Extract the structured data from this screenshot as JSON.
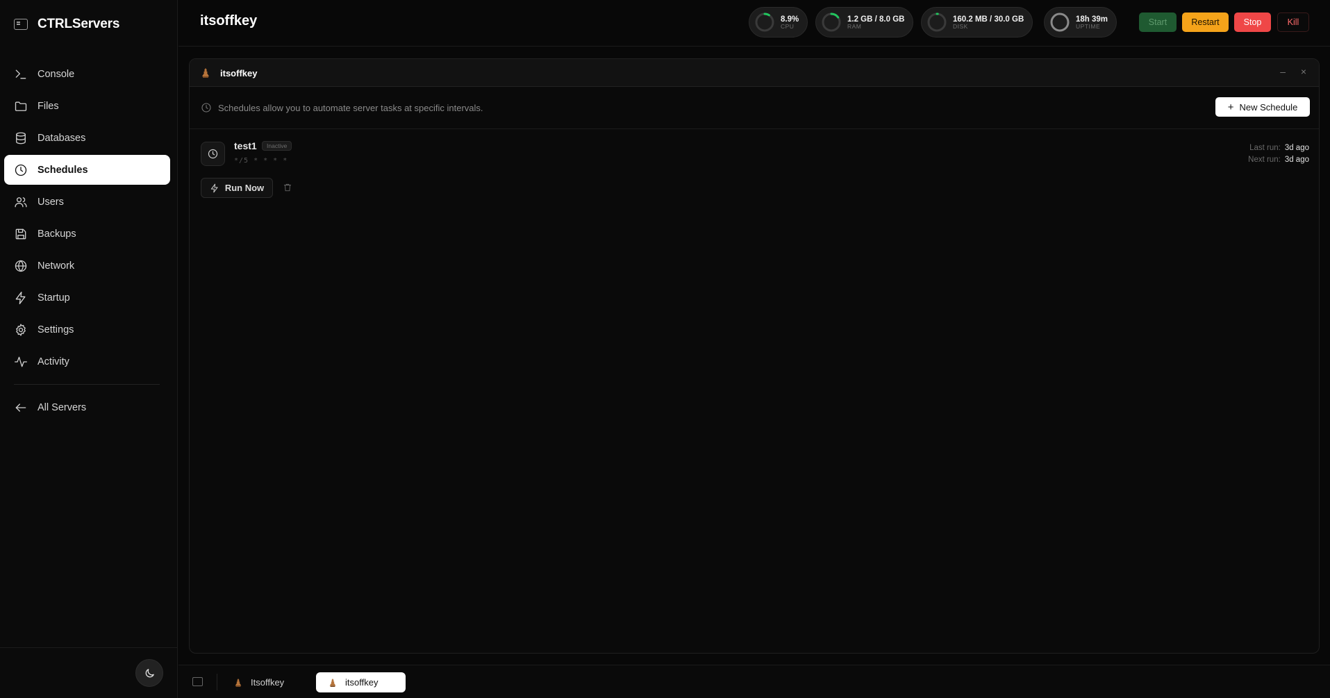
{
  "brand": {
    "name": "CTRLServers"
  },
  "sidebar": {
    "items": [
      {
        "label": "Console",
        "icon": "terminal-icon",
        "active": false
      },
      {
        "label": "Files",
        "icon": "folder-icon",
        "active": false
      },
      {
        "label": "Databases",
        "icon": "database-icon",
        "active": false
      },
      {
        "label": "Schedules",
        "icon": "clock-icon",
        "active": true
      },
      {
        "label": "Users",
        "icon": "users-icon",
        "active": false
      },
      {
        "label": "Backups",
        "icon": "save-icon",
        "active": false
      },
      {
        "label": "Network",
        "icon": "globe-icon",
        "active": false
      },
      {
        "label": "Startup",
        "icon": "lightning-icon",
        "active": false
      },
      {
        "label": "Settings",
        "icon": "gear-icon",
        "active": false
      },
      {
        "label": "Activity",
        "icon": "activity-icon",
        "active": false
      }
    ],
    "back_label": "All Servers"
  },
  "header": {
    "server_name": "itsoffkey",
    "stats": [
      {
        "value": "8.9%",
        "label": "CPU",
        "fraction": 0.089
      },
      {
        "value": "1.2 GB / 8.0 GB",
        "label": "RAM",
        "fraction": 0.15
      },
      {
        "value": "160.2 MB / 30.0 GB",
        "label": "DISK",
        "fraction": 0.0053
      },
      {
        "value": "18h 39m",
        "label": "UPTIME",
        "fraction": 1.0
      }
    ],
    "power": {
      "start": "Start",
      "restart": "Restart",
      "stop": "Stop",
      "kill": "Kill"
    }
  },
  "panel": {
    "title": "itsoffkey",
    "info": "Schedules allow you to automate server tasks at specific intervals.",
    "new_schedule_label": "New Schedule",
    "schedules": [
      {
        "name": "test1",
        "status": "Inactive",
        "cron": "*/5 * * * *",
        "run_now_label": "Run Now",
        "last_run_label": "Last run:",
        "last_run": "3d ago",
        "next_run_label": "Next run:",
        "next_run": "3d ago"
      }
    ]
  },
  "taskbar": {
    "tabs": [
      {
        "label": "Itsoffkey",
        "active": false
      },
      {
        "label": "itsoffkey",
        "active": true
      }
    ]
  },
  "colors": {
    "accent_green": "#22c55e",
    "restart": "#f5a31a",
    "stop": "#ef4747",
    "start_bg": "#1f5a31"
  }
}
